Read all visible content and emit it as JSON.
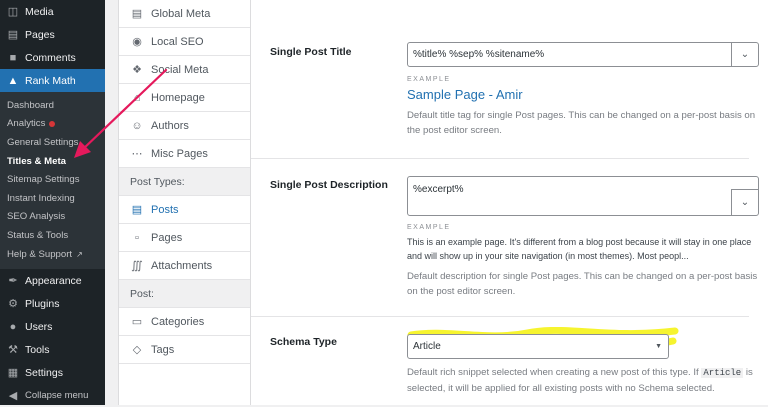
{
  "wp_menu": {
    "top_items": [
      {
        "icon": "media-icon",
        "label": "Media"
      },
      {
        "icon": "pages-icon",
        "label": "Pages"
      },
      {
        "icon": "comments-icon",
        "label": "Comments"
      }
    ],
    "rank_math": {
      "icon": "rank-math-icon",
      "label": "Rank Math"
    },
    "submenu": [
      {
        "label": "Dashboard"
      },
      {
        "label": "Analytics",
        "badge": "dot"
      },
      {
        "label": "General Settings"
      },
      {
        "label": "Titles & Meta",
        "current": true
      },
      {
        "label": "Sitemap Settings"
      },
      {
        "label": "Instant Indexing"
      },
      {
        "label": "SEO Analysis"
      },
      {
        "label": "Status & Tools"
      },
      {
        "label": "Help & Support",
        "external": true
      }
    ],
    "bottom_items": [
      {
        "icon": "appearance-icon",
        "label": "Appearance"
      },
      {
        "icon": "plugins-icon",
        "label": "Plugins"
      },
      {
        "icon": "users-icon",
        "label": "Users"
      },
      {
        "icon": "tools-icon",
        "label": "Tools"
      },
      {
        "icon": "settings-icon",
        "label": "Settings"
      },
      {
        "icon": "collapse-icon",
        "label": "Collapse menu"
      }
    ]
  },
  "settings_nav": {
    "items_top": [
      {
        "icon": "globe-icon",
        "label": "Global Meta"
      },
      {
        "icon": "location-pin-icon",
        "label": "Local SEO"
      },
      {
        "icon": "share-icon",
        "label": "Social Meta"
      },
      {
        "icon": "home-icon",
        "label": "Homepage"
      },
      {
        "icon": "authors-icon",
        "label": "Authors"
      },
      {
        "icon": "misc-icon",
        "label": "Misc Pages"
      }
    ],
    "group_post_types": "Post Types:",
    "post_types": [
      {
        "icon": "posts-icon",
        "label": "Posts",
        "active": true
      },
      {
        "icon": "pages-doc-icon",
        "label": "Pages"
      },
      {
        "icon": "attachment-icon",
        "label": "Attachments"
      }
    ],
    "group_post": "Post:",
    "post_items": [
      {
        "icon": "folder-icon",
        "label": "Categories"
      },
      {
        "icon": "tag-icon",
        "label": "Tags"
      }
    ]
  },
  "title_field": {
    "label": "Single Post Title",
    "value": "%title% %sep% %sitename%",
    "example_label": "EXAMPLE",
    "example_value": "Sample Page - Amir",
    "help": "Default title tag for single Post pages. This can be changed on a per-post basis on the post editor screen."
  },
  "description_field": {
    "label": "Single Post Description",
    "value": "%excerpt%",
    "example_label": "EXAMPLE",
    "example_value": "This is an example page. It's different from a blog post because it will stay in one place and will show up in your site navigation (in most themes). Most peopl...",
    "help": "Default description for single Post pages. This can be changed on a per-post basis on the post editor screen."
  },
  "schema_field": {
    "label": "Schema Type",
    "value": "Article",
    "help_before": "Default rich snippet selected when creating a new post of this type. If",
    "help_code": "Article",
    "help_after": "is selected, it will be applied for all existing posts with no Schema selected."
  },
  "colors": {
    "accent": "#2271b1",
    "annotation_arrow": "#e5195c",
    "highlighter": "#f4f20a"
  }
}
